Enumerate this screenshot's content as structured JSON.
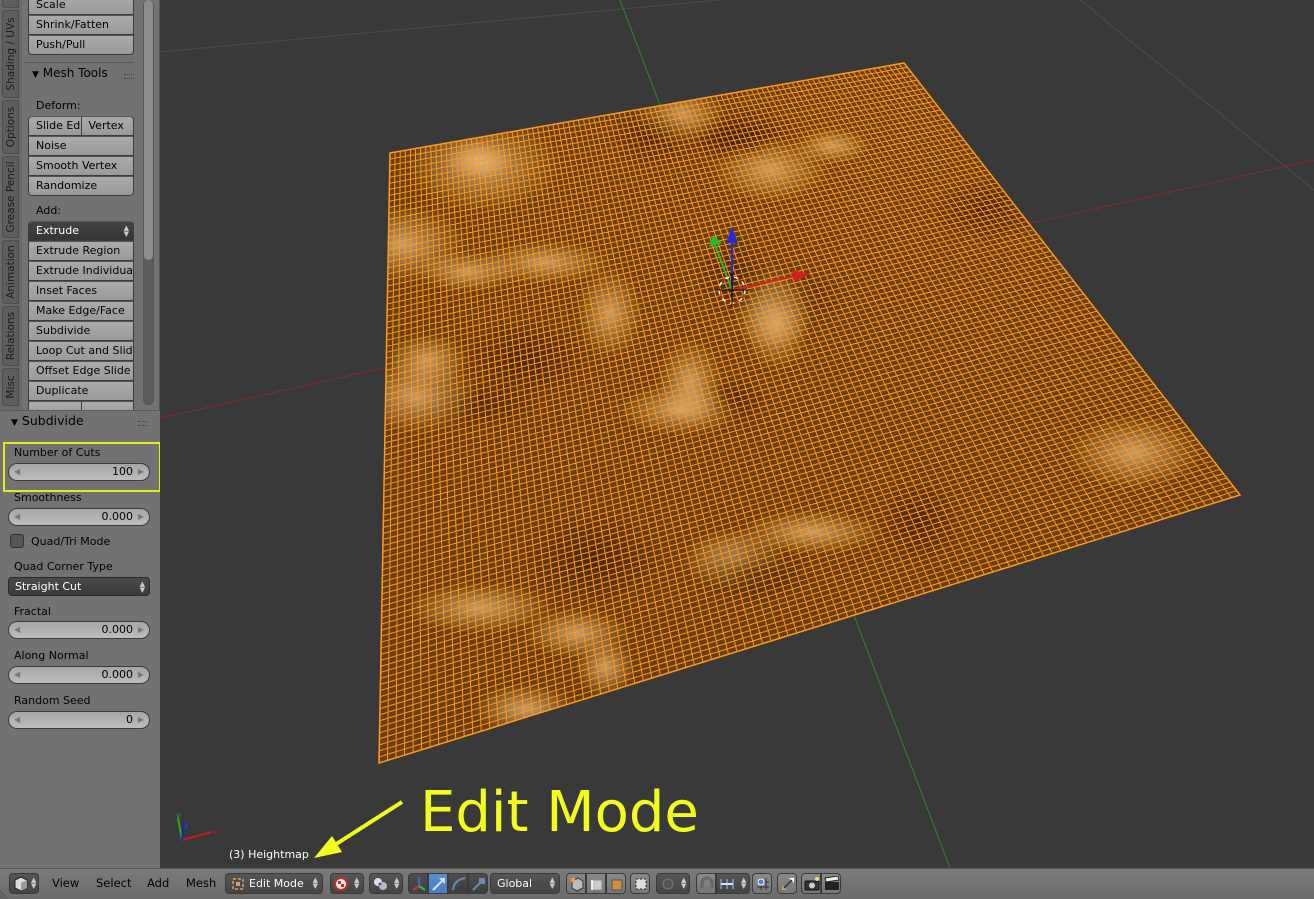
{
  "toolshelf": {
    "tabs": [
      "Shading / UVs",
      "Options",
      "Grease Pencil",
      "Animation",
      "Relations",
      "Misc"
    ],
    "transform_buttons": [
      "Scale",
      "Shrink/Fatten",
      "Push/Pull"
    ],
    "mesh_tools": {
      "title": "Mesh Tools",
      "deform_label": "Deform:",
      "deform_split": [
        "Slide Ed",
        "Vertex"
      ],
      "deform_buttons": [
        "Noise",
        "Smooth Vertex",
        "Randomize"
      ],
      "add_label": "Add:",
      "extrude_dropdown": "Extrude",
      "add_buttons": [
        "Extrude Region",
        "Extrude Individual",
        "Inset Faces",
        "Make Edge/Face",
        "Subdivide",
        "Loop Cut and Slide",
        "Offset Edge Slide",
        "Duplicate"
      ]
    }
  },
  "operator_panel": {
    "title": "Subdivide",
    "number_of_cuts": {
      "label": "Number of Cuts",
      "value": "100"
    },
    "smoothness": {
      "label": "Smoothness",
      "value": "0.000"
    },
    "quad_tri_mode": {
      "label": "Quad/Tri Mode",
      "checked": false
    },
    "quad_corner_type": {
      "label": "Quad Corner Type",
      "value": "Straight Cut"
    },
    "fractal": {
      "label": "Fractal",
      "value": "0.000"
    },
    "along_normal": {
      "label": "Along Normal",
      "value": "0.000"
    },
    "random_seed": {
      "label": "Random Seed",
      "value": "0"
    }
  },
  "viewport": {
    "object_label": "(3) Heightmap",
    "annotation": "Edit Mode",
    "annotation_color": "#f4fc1c",
    "mesh_color": "#ff9a1a"
  },
  "header": {
    "menus": [
      "View",
      "Select",
      "Add",
      "Mesh"
    ],
    "mode": "Edit Mode",
    "orientation": "Global"
  }
}
